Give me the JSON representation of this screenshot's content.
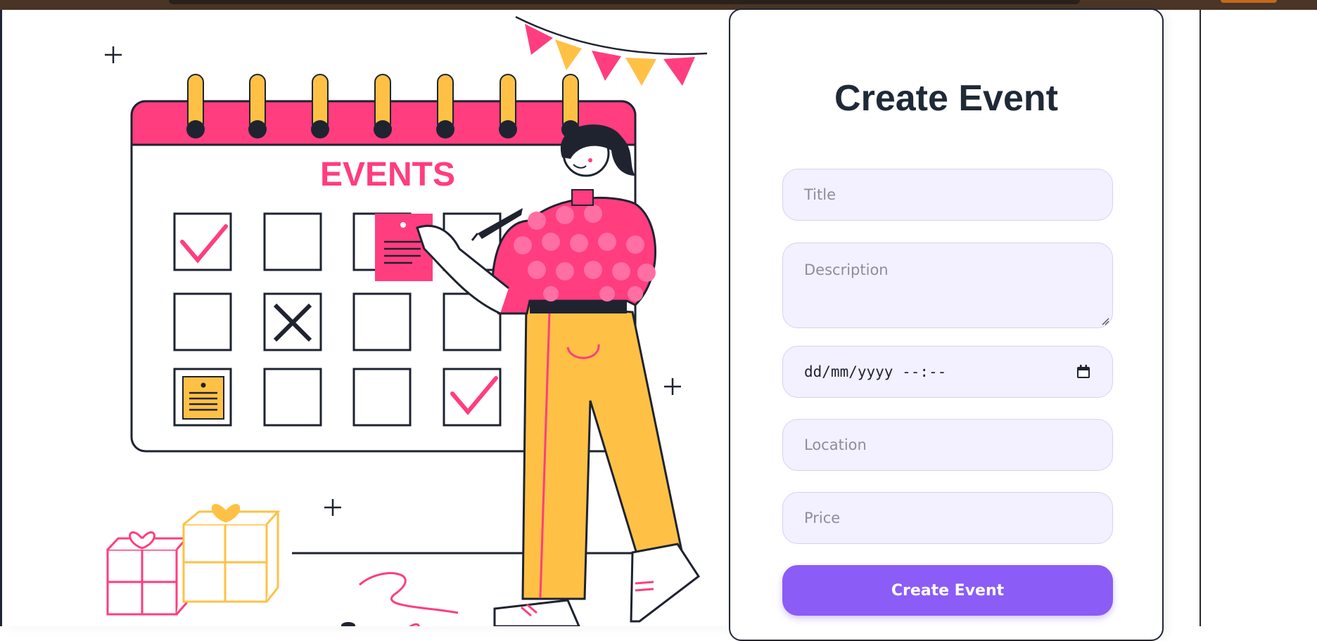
{
  "form": {
    "title": "Create Event",
    "title_placeholder": "Title",
    "description_placeholder": "Description",
    "datetime_placeholder": "dd/mm/yyyy  --:--",
    "location_placeholder": "Location",
    "price_placeholder": "Price",
    "submit_label": "Create Event"
  },
  "illustration": {
    "calendar_heading": "EVENTS"
  },
  "colors": {
    "accent": "#8b5cf6",
    "input_bg": "#f3f0ff",
    "title_text": "#1f2937",
    "pink": "#ff3d7f",
    "yellow": "#ffc145"
  }
}
